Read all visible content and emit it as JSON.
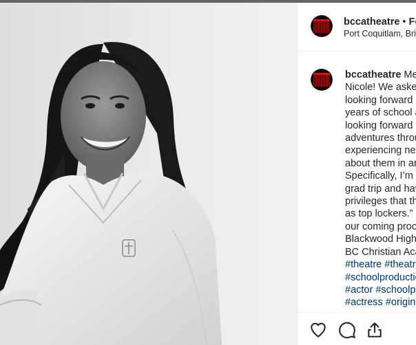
{
  "header": {
    "username": "bccatheatre",
    "separator": " • ",
    "follow_label": "Fo",
    "location": "Port Coquitlam, Brit"
  },
  "caption": {
    "username": "bccatheatre",
    "first_words": " Mee",
    "lines": [
      "Nicole! We asked",
      "looking forward",
      "years of school a",
      "looking forward",
      "adventures throu",
      "experiencing nev",
      "about them in ar",
      "Specifically, I’m l",
      "grad trip and hav",
      "privileges that th",
      "as top lockers.” S",
      "our coming proc",
      "Blackwood Hight",
      "BC Christian Aca"
    ],
    "hashtag_lines": [
      [
        "#theatre",
        "#theatr"
      ],
      [
        "#schoolproductio"
      ],
      [
        "#actor",
        "#schoolpl"
      ],
      [
        "#actress",
        "#origina"
      ]
    ]
  },
  "actions": {
    "like_icon": "heart-icon",
    "comment_icon": "comment-icon",
    "share_icon": "share-icon"
  },
  "colors": {
    "accent_link": "#00376b",
    "text": "#262626",
    "avatar_red": "#8b0c0c"
  }
}
